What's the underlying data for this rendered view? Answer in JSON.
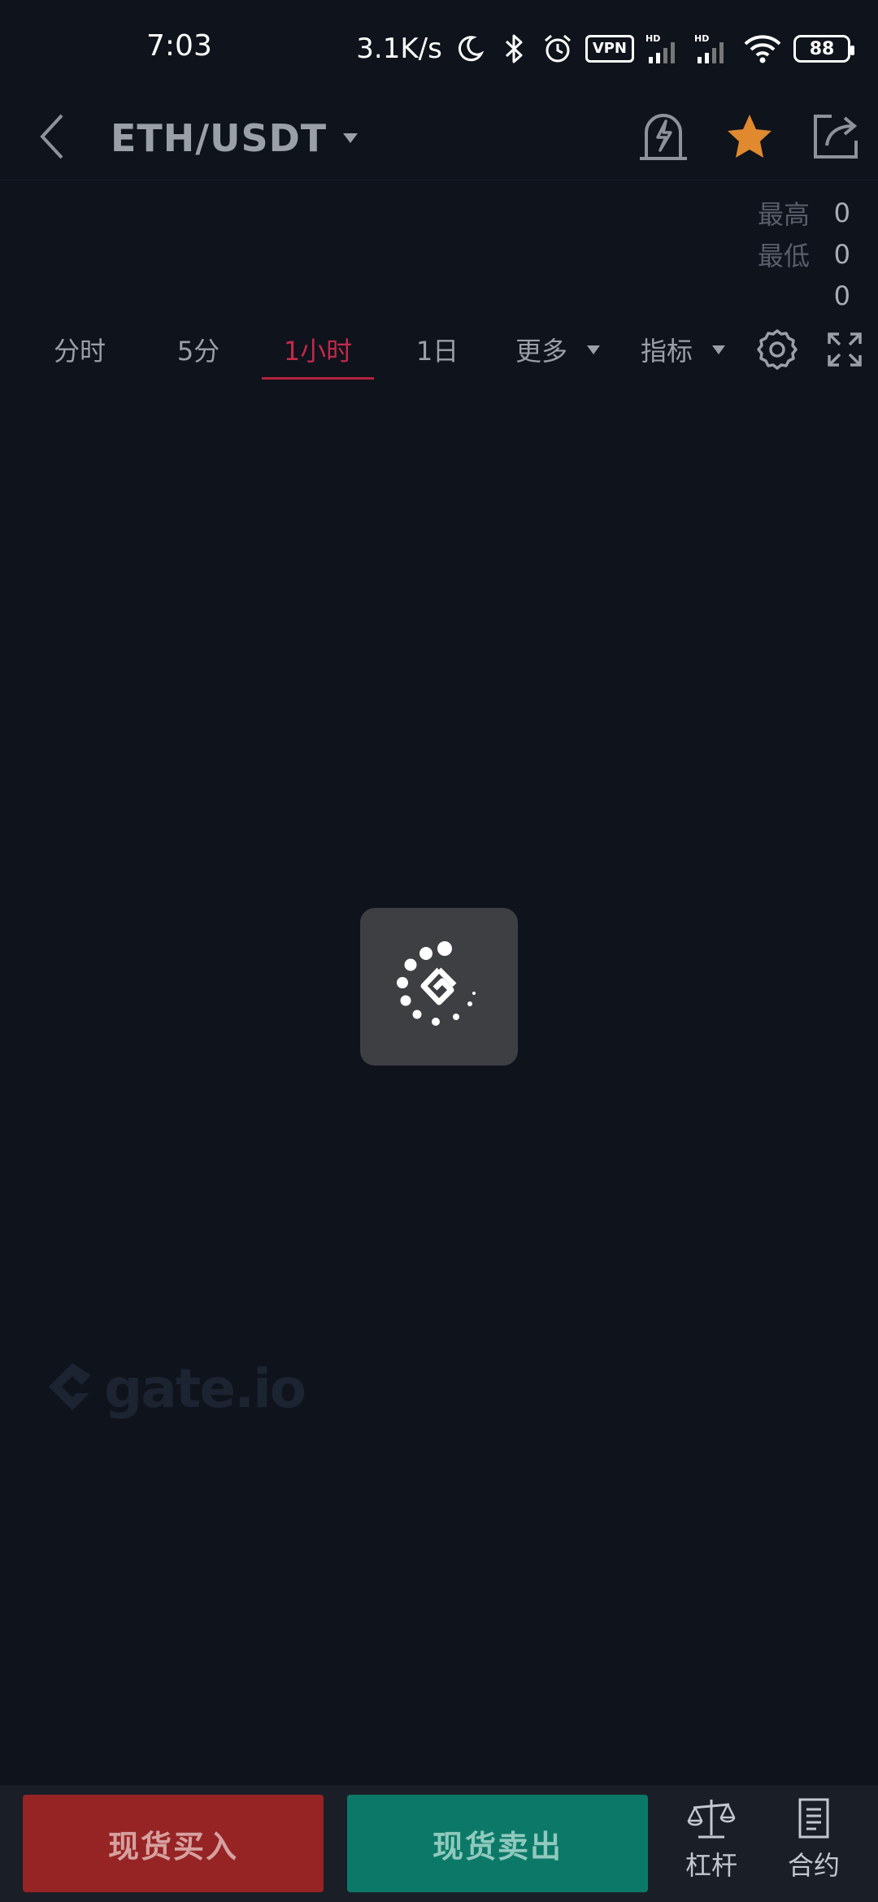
{
  "status_bar": {
    "time": "7:03",
    "net_speed": "3.1K/s",
    "vpn": "VPN",
    "battery": "88",
    "hd": "HD"
  },
  "header": {
    "pair": "ETH/USDT"
  },
  "stats": {
    "high_label": "最高",
    "high_value": "0",
    "low_label": "最低",
    "low_value": "0",
    "volume_value": "0"
  },
  "intervals": {
    "tabs": [
      "分时",
      "5分",
      "1小时",
      "1日"
    ],
    "active_index": 2,
    "more_label": "更多",
    "indicator_label": "指标"
  },
  "watermark": {
    "text": "gate.io"
  },
  "bottom_bar": {
    "buy_label": "现货买入",
    "sell_label": "现货卖出",
    "margin_label": "杠杆",
    "futures_label": "合约"
  },
  "colors": {
    "background": "#0f131c",
    "active_tab": "#c2294a",
    "favorite_star": "#e0892f",
    "buy": "#962424",
    "sell": "#0c7968"
  }
}
